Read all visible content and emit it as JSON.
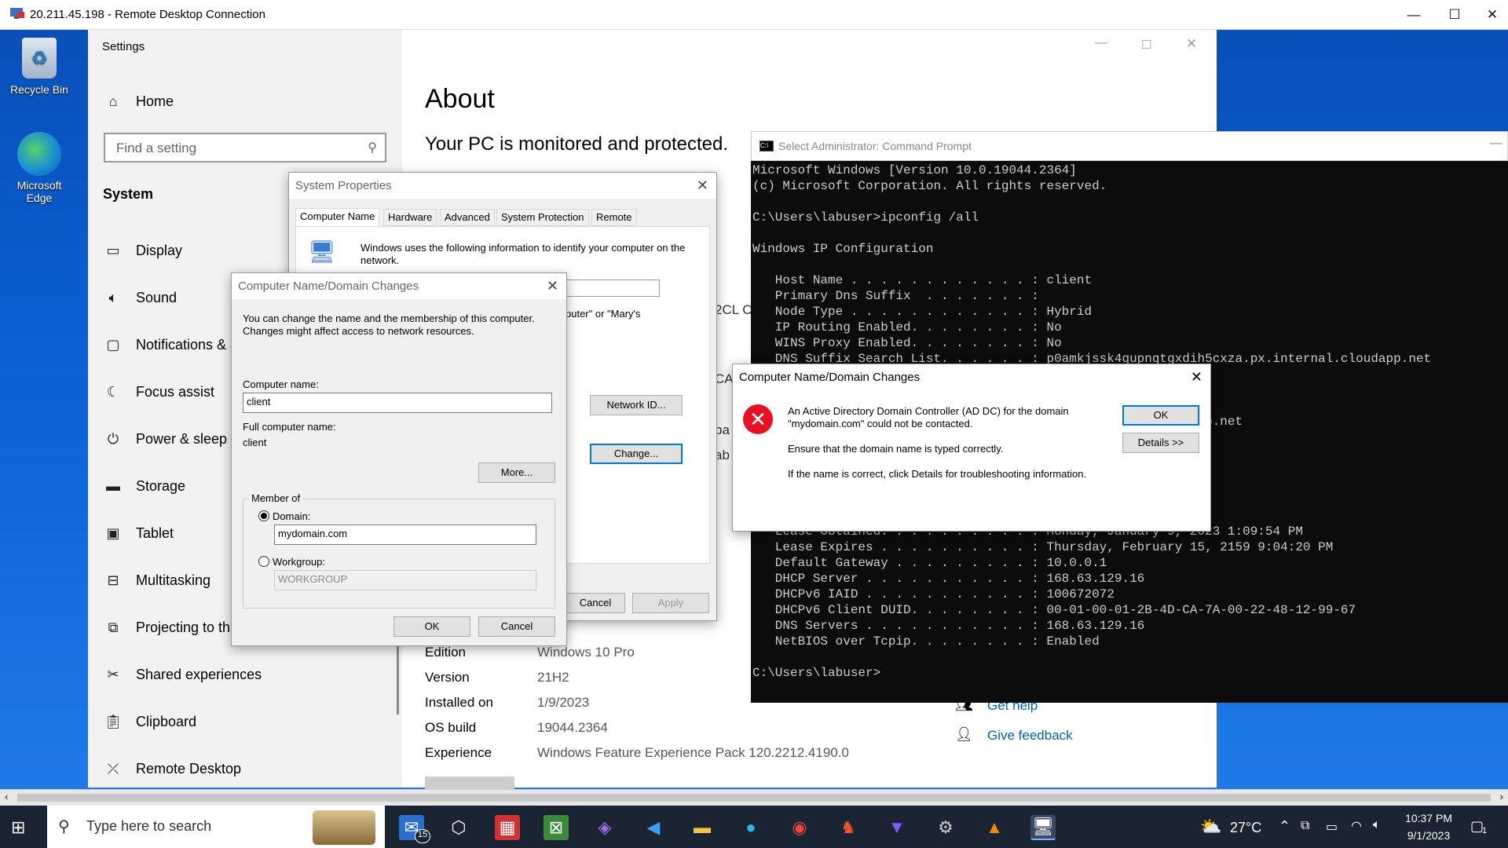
{
  "rdp": {
    "title": "20.211.45.198 - Remote Desktop Connection"
  },
  "desktop": {
    "recycle": "Recycle Bin",
    "edge": "Microsoft Edge"
  },
  "settings": {
    "app": "Settings",
    "home": "Home",
    "search_placeholder": "Find a setting",
    "section": "System",
    "nav": [
      "Display",
      "Sound",
      "Notifications & a",
      "Focus assist",
      "Power & sleep",
      "Storage",
      "Tablet",
      "Multitasking",
      "Projecting to thi",
      "Shared experiences",
      "Clipboard",
      "Remote Desktop"
    ],
    "heading": "About",
    "subheading": "Your PC is monitored and protected.",
    "specs": [
      {
        "k": "Edition",
        "v": "Windows 10 Pro"
      },
      {
        "k": "Version",
        "v": "21H2"
      },
      {
        "k": "Installed on",
        "v": "1/9/2023"
      },
      {
        "k": "OS build",
        "v": "19044.2364"
      },
      {
        "k": "Experience",
        "v": "Windows Feature Experience Pack 120.2212.4190.0"
      }
    ],
    "get_help": "Get help",
    "give_feedback": "Give feedback",
    "frag1": "2CL C",
    "frag2": "CA",
    "frag3": "ba",
    "frag4": "ab"
  },
  "sysprops": {
    "title": "System Properties",
    "tabs": [
      "Computer Name",
      "Hardware",
      "Advanced",
      "System Protection",
      "Remote"
    ],
    "info": "Windows uses the following information to identify your computer on the network.",
    "frag": "puter\" or \"Mary's",
    "network_id": "Network ID...",
    "change": "Change...",
    "cancel": "Cancel",
    "apply": "Apply"
  },
  "namechange": {
    "title": "Computer Name/Domain Changes",
    "desc": "You can change the name and the membership of this computer. Changes might affect access to network resources.",
    "computer_name_label": "Computer name:",
    "computer_name": "client",
    "full_label": "Full computer name:",
    "full": "client",
    "more": "More...",
    "member_of": "Member of",
    "domain_label": "Domain:",
    "domain": "mydomain.com",
    "workgroup_label": "Workgroup:",
    "workgroup": "WORKGROUP",
    "ok": "OK",
    "cancel": "Cancel"
  },
  "error": {
    "title": "Computer Name/Domain Changes",
    "line1": "An Active Directory Domain Controller (AD DC) for the domain",
    "line2": "\"mydomain.com\" could not be contacted.",
    "line3": "Ensure that the domain name is typed correctly.",
    "line4": "If the name is correct, click Details for troubleshooting information.",
    "ok": "OK",
    "details": "Details >>"
  },
  "cmd": {
    "title": "Select Administrator: Command Prompt",
    "text": "Microsoft Windows [Version 10.0.19044.2364]\n(c) Microsoft Corporation. All rights reserved.\n\nC:\\Users\\labuser>ipconfig /all\n\nWindows IP Configuration\n\n   Host Name . . . . . . . . . . . . : client\n   Primary Dns Suffix  . . . . . . . :\n   Node Type . . . . . . . . . . . . : Hybrid\n   IP Routing Enabled. . . . . . . . : No\n   WINS Proxy Enabled. . . . . . . . : No\n   DNS Suffix Search List. . . . . . : p0amkjssk4qupnqtgxdih5cxza.px.internal.cloudapp.net\n\n\n\n                                        .px.internal.cloudapp.net\n                                        Adapter\n\n\n\n                                        6(Preferred)\n\n   Lease Obtained. . . . . . . . . . : Monday, January 9, 2023 1:09:54 PM\n   Lease Expires . . . . . . . . . . : Thursday, February 15, 2159 9:04:20 PM\n   Default Gateway . . . . . . . . . : 10.0.0.1\n   DHCP Server . . . . . . . . . . . : 168.63.129.16\n   DHCPv6 IAID . . . . . . . . . . . : 100672072\n   DHCPv6 Client DUID. . . . . . . . : 00-01-00-01-2B-4D-CA-7A-00-22-48-12-99-67\n   DNS Servers . . . . . . . . . . . : 168.63.129.16\n   NetBIOS over Tcpip. . . . . . . . : Enabled\n\nC:\\Users\\labuser>"
  },
  "taskbar": {
    "search_placeholder": "Type here to search",
    "mail_badge": "15",
    "weather": "27°C",
    "time": "10:37 PM",
    "date": "9/1/2023",
    "notif_count": "1"
  }
}
